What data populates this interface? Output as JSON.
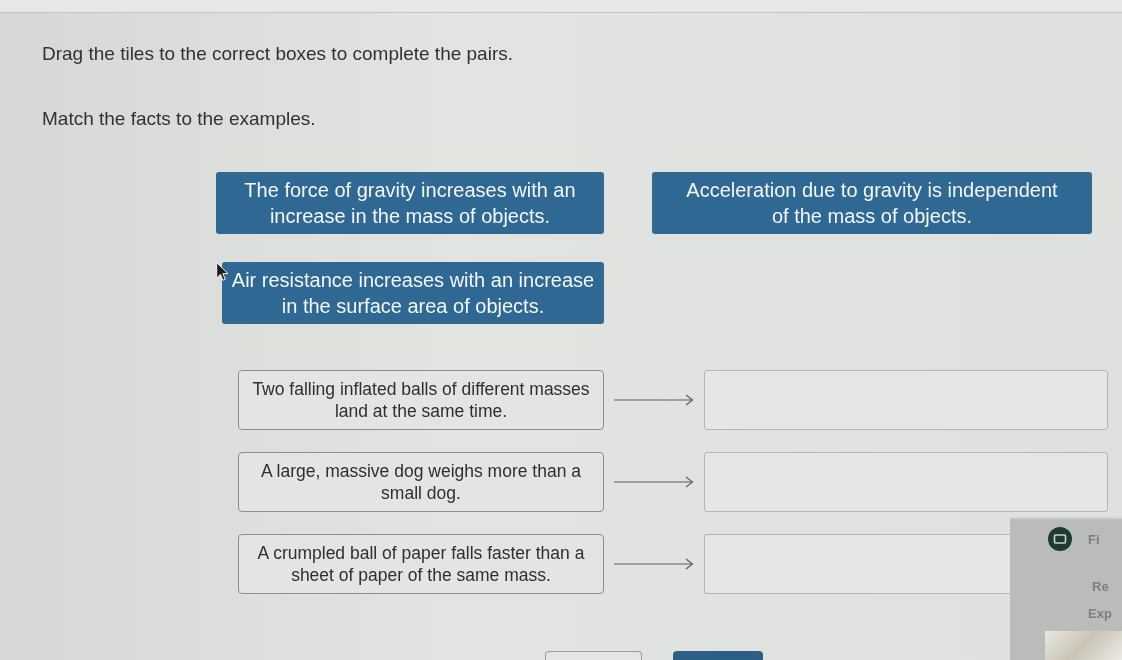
{
  "instructions": [
    "Drag the tiles to the correct boxes to complete the pairs.",
    "Match the facts to the examples."
  ],
  "tiles": [
    {
      "text": "The force of gravity increases with an increase in the mass of objects."
    },
    {
      "text": "Acceleration due to gravity is independent of the mass of objects."
    },
    {
      "text": "Air resistance increases with an increase in the surface area of objects."
    }
  ],
  "pairs": [
    {
      "example": "Two falling inflated balls of different masses land at the same time."
    },
    {
      "example": "A large, massive dog weighs more than a small dog."
    },
    {
      "example": "A crumpled ball of paper falls faster than a sheet of paper of the same mass."
    }
  ],
  "side_panel": {
    "items": [
      "Fi",
      "Re",
      "Exp"
    ]
  },
  "footer_buttons": [
    {
      "kind": "outline"
    },
    {
      "kind": "primary"
    }
  ]
}
